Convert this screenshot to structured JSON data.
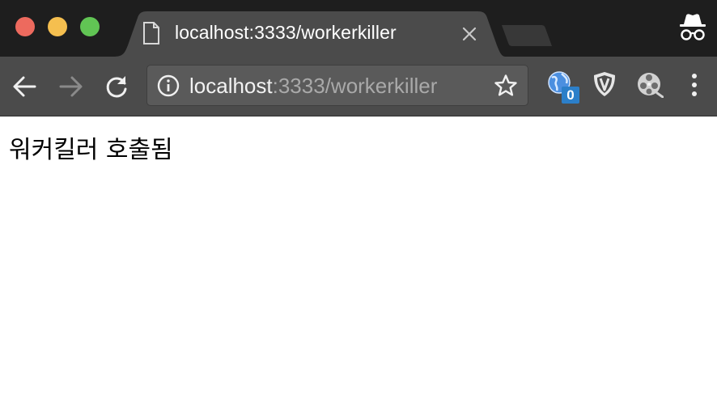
{
  "window": {
    "traffic_lights": [
      "close",
      "minimize",
      "zoom"
    ]
  },
  "tab": {
    "title": "localhost:3333/workerkiller",
    "icon": "page-icon",
    "close_icon": "close-icon"
  },
  "toolbar": {
    "back_icon": "back-arrow-icon",
    "forward_icon": "forward-arrow-icon",
    "reload_icon": "reload-icon",
    "address": {
      "host": "localhost",
      "rest": ":3333/workerkiller"
    },
    "extensions": [
      {
        "icon": "globe-extension-icon",
        "badge": "0"
      },
      {
        "icon": "shield-extension-icon"
      },
      {
        "icon": "film-reel-extension-icon"
      }
    ]
  },
  "page": {
    "message": "워커킬러 호출됨"
  },
  "colors": {
    "titlebar": "#1e1e1e",
    "tab_active": "#4b4b4b",
    "toolbar": "#4b4b4b",
    "omnibox": "#5a5a5a",
    "badge": "#2c7fc9"
  }
}
